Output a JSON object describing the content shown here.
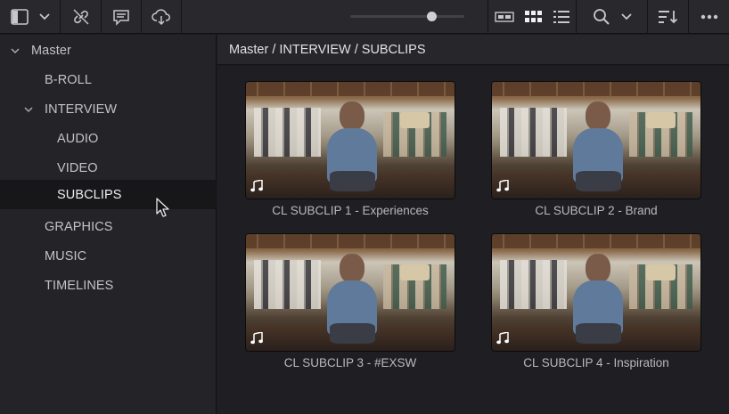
{
  "toolbar": {
    "icons": [
      "sidebar-toggle-icon",
      "chevron-down-icon",
      "unlink-icon",
      "metadata-icon",
      "cloud-sync-icon",
      "strip-view-icon",
      "thumbnail-view-icon",
      "list-view-icon",
      "search-icon",
      "chevron-down-icon",
      "sort-icon",
      "more-options-icon"
    ],
    "zoom_level": 0.66
  },
  "sidebar": {
    "items": [
      {
        "label": "Master",
        "expanded": true
      },
      {
        "label": "B-ROLL"
      },
      {
        "label": "INTERVIEW",
        "expanded": true
      },
      {
        "label": "AUDIO"
      },
      {
        "label": "VIDEO"
      },
      {
        "label": "SUBCLIPS",
        "selected": true
      },
      {
        "label": "GRAPHICS"
      },
      {
        "label": "MUSIC"
      },
      {
        "label": "TIMELINES"
      }
    ]
  },
  "breadcrumb": "Master / INTERVIEW / SUBCLIPS",
  "clips": [
    {
      "name": "CL SUBCLIP 1 - Experiences",
      "icon": "music-note-icon"
    },
    {
      "name": "CL SUBCLIP 2 - Brand",
      "icon": "music-note-icon"
    },
    {
      "name": "CL SUBCLIP 3 - #EXSW",
      "icon": "music-note-icon"
    },
    {
      "name": "CL SUBCLIP 4 - Inspiration",
      "icon": "music-note-icon"
    }
  ],
  "colors": {
    "toolbar_bg": "#28282d",
    "sidebar_bg": "#232328",
    "selected_bg": "#17171a",
    "main_bg": "#1e1e23"
  }
}
